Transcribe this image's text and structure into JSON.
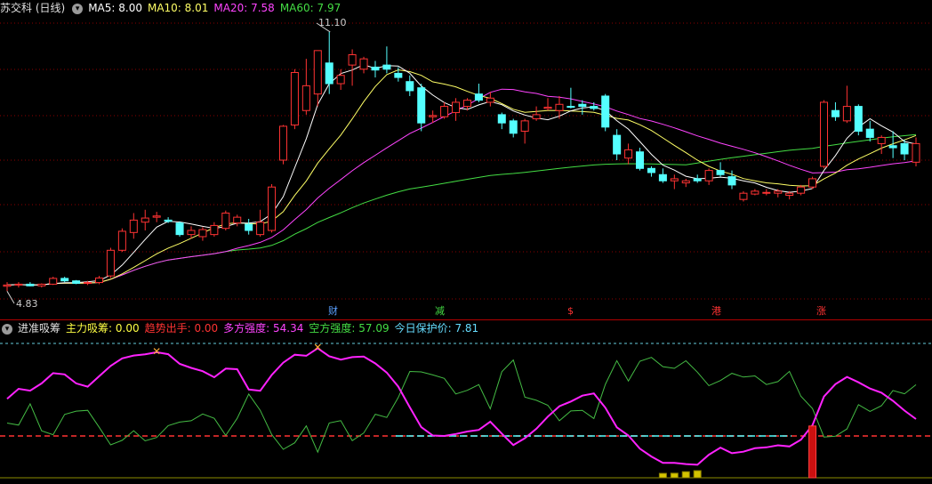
{
  "top_panel": {
    "stock": "苏交科 (日线)",
    "indicators": [
      {
        "label": "MA5: 8.00",
        "color": "#ffffff"
      },
      {
        "label": "MA10: 8.01",
        "color": "#ffff66"
      },
      {
        "label": "MA20: 7.58",
        "color": "#ff44ff"
      },
      {
        "label": "MA60: 7.97",
        "color": "#44dd44"
      }
    ],
    "high_label": "11.10",
    "low_label": "4.83",
    "news_tags": [
      {
        "text": "财",
        "color": "#5aa0ff"
      },
      {
        "text": "减",
        "color": "#44dd44"
      },
      {
        "text": "$",
        "color": "#ff3333"
      },
      {
        "text": "港",
        "color": "#ff3333"
      },
      {
        "text": "涨",
        "color": "#ff3333"
      }
    ]
  },
  "bottom_panel": {
    "name": "进准吸筹",
    "indicators": [
      {
        "label": "主力吸筹: 0.00",
        "color": "#ffff44"
      },
      {
        "label": "趋势出手: 0.00",
        "color": "#ff3333"
      },
      {
        "label": "多方强度: 54.34",
        "color": "#ff44ff"
      },
      {
        "label": "空方强度: 57.09",
        "color": "#44dd44"
      },
      {
        "label": "今日保护价: 7.81",
        "color": "#66ddff"
      }
    ]
  },
  "chart_data": {
    "type": "candlestick",
    "candles": [
      {
        "o": 4.95,
        "h": 5.05,
        "l": 4.83,
        "c": 4.98
      },
      {
        "o": 4.98,
        "h": 5.05,
        "l": 4.92,
        "c": 5.0
      },
      {
        "o": 5.0,
        "h": 5.05,
        "l": 4.95,
        "c": 4.96
      },
      {
        "o": 4.96,
        "h": 5.02,
        "l": 4.92,
        "c": 5.0
      },
      {
        "o": 5.0,
        "h": 5.18,
        "l": 4.98,
        "c": 5.14
      },
      {
        "o": 5.14,
        "h": 5.18,
        "l": 5.05,
        "c": 5.08
      },
      {
        "o": 5.08,
        "h": 5.1,
        "l": 5.0,
        "c": 5.02
      },
      {
        "o": 5.02,
        "h": 5.08,
        "l": 4.98,
        "c": 5.04
      },
      {
        "o": 5.04,
        "h": 5.2,
        "l": 5.0,
        "c": 5.15
      },
      {
        "o": 5.2,
        "h": 5.88,
        "l": 5.15,
        "c": 5.82
      },
      {
        "o": 5.82,
        "h": 6.35,
        "l": 5.78,
        "c": 6.28
      },
      {
        "o": 6.25,
        "h": 6.72,
        "l": 6.1,
        "c": 6.55
      },
      {
        "o": 6.5,
        "h": 6.8,
        "l": 6.3,
        "c": 6.6
      },
      {
        "o": 6.62,
        "h": 6.75,
        "l": 6.5,
        "c": 6.65
      },
      {
        "o": 6.55,
        "h": 6.62,
        "l": 6.48,
        "c": 6.52
      },
      {
        "o": 6.48,
        "h": 6.52,
        "l": 6.15,
        "c": 6.2
      },
      {
        "o": 6.2,
        "h": 6.4,
        "l": 6.1,
        "c": 6.3
      },
      {
        "o": 6.15,
        "h": 6.38,
        "l": 6.05,
        "c": 6.32
      },
      {
        "o": 6.2,
        "h": 6.5,
        "l": 6.15,
        "c": 6.42
      },
      {
        "o": 6.35,
        "h": 6.78,
        "l": 6.3,
        "c": 6.72
      },
      {
        "o": 6.48,
        "h": 6.68,
        "l": 6.4,
        "c": 6.62
      },
      {
        "o": 6.45,
        "h": 6.58,
        "l": 6.2,
        "c": 6.3
      },
      {
        "o": 6.2,
        "h": 6.8,
        "l": 6.15,
        "c": 6.5
      },
      {
        "o": 6.3,
        "h": 7.42,
        "l": 6.25,
        "c": 7.35
      },
      {
        "o": 8.0,
        "h": 8.85,
        "l": 7.9,
        "c": 8.82
      },
      {
        "o": 8.85,
        "h": 10.2,
        "l": 8.75,
        "c": 10.12
      },
      {
        "o": 9.2,
        "h": 10.45,
        "l": 9.1,
        "c": 9.8
      },
      {
        "o": 9.6,
        "h": 10.55,
        "l": 9.3,
        "c": 10.65
      },
      {
        "o": 10.35,
        "h": 11.1,
        "l": 9.6,
        "c": 9.85
      },
      {
        "o": 9.85,
        "h": 10.2,
        "l": 9.7,
        "c": 10.05
      },
      {
        "o": 10.3,
        "h": 10.68,
        "l": 9.8,
        "c": 10.55
      },
      {
        "o": 10.2,
        "h": 10.5,
        "l": 10.1,
        "c": 10.45
      },
      {
        "o": 10.25,
        "h": 10.4,
        "l": 10.0,
        "c": 10.18
      },
      {
        "o": 10.3,
        "h": 10.75,
        "l": 10.1,
        "c": 10.2
      },
      {
        "o": 10.1,
        "h": 10.25,
        "l": 9.9,
        "c": 10.0
      },
      {
        "o": 9.9,
        "h": 10.05,
        "l": 9.55,
        "c": 9.68
      },
      {
        "o": 9.75,
        "h": 9.85,
        "l": 8.7,
        "c": 8.9
      },
      {
        "o": 9.05,
        "h": 9.2,
        "l": 8.9,
        "c": 9.08
      },
      {
        "o": 9.05,
        "h": 9.4,
        "l": 9.0,
        "c": 9.3
      },
      {
        "o": 9.15,
        "h": 9.5,
        "l": 8.95,
        "c": 9.4
      },
      {
        "o": 9.3,
        "h": 9.5,
        "l": 9.2,
        "c": 9.45
      },
      {
        "o": 9.6,
        "h": 9.85,
        "l": 9.4,
        "c": 9.45
      },
      {
        "o": 9.4,
        "h": 9.65,
        "l": 9.3,
        "c": 9.5
      },
      {
        "o": 9.1,
        "h": 9.15,
        "l": 8.75,
        "c": 8.9
      },
      {
        "o": 8.95,
        "h": 9.0,
        "l": 8.55,
        "c": 8.65
      },
      {
        "o": 8.7,
        "h": 9.0,
        "l": 8.4,
        "c": 8.95
      },
      {
        "o": 9.0,
        "h": 9.3,
        "l": 8.95,
        "c": 9.1
      },
      {
        "o": 9.25,
        "h": 9.5,
        "l": 9.2,
        "c": 9.28
      },
      {
        "o": 9.2,
        "h": 9.55,
        "l": 9.0,
        "c": 9.35
      },
      {
        "o": 9.3,
        "h": 9.75,
        "l": 9.25,
        "c": 9.28
      },
      {
        "o": 9.35,
        "h": 9.45,
        "l": 9.1,
        "c": 9.3
      },
      {
        "o": 9.3,
        "h": 9.4,
        "l": 9.2,
        "c": 9.25
      },
      {
        "o": 9.55,
        "h": 9.6,
        "l": 8.7,
        "c": 8.8
      },
      {
        "o": 8.6,
        "h": 8.75,
        "l": 8.0,
        "c": 8.15
      },
      {
        "o": 8.05,
        "h": 8.4,
        "l": 7.9,
        "c": 8.25
      },
      {
        "o": 8.2,
        "h": 8.3,
        "l": 7.75,
        "c": 7.8
      },
      {
        "o": 7.8,
        "h": 7.85,
        "l": 7.6,
        "c": 7.7
      },
      {
        "o": 7.65,
        "h": 7.8,
        "l": 7.45,
        "c": 7.5
      },
      {
        "o": 7.5,
        "h": 7.65,
        "l": 7.3,
        "c": 7.55
      },
      {
        "o": 7.45,
        "h": 7.55,
        "l": 7.35,
        "c": 7.5
      },
      {
        "o": 7.55,
        "h": 7.65,
        "l": 7.45,
        "c": 7.5
      },
      {
        "o": 7.5,
        "h": 7.8,
        "l": 7.4,
        "c": 7.75
      },
      {
        "o": 7.75,
        "h": 7.95,
        "l": 7.6,
        "c": 7.65
      },
      {
        "o": 7.6,
        "h": 7.75,
        "l": 7.3,
        "c": 7.4
      },
      {
        "o": 7.05,
        "h": 7.25,
        "l": 7.0,
        "c": 7.2
      },
      {
        "o": 7.18,
        "h": 7.3,
        "l": 7.15,
        "c": 7.25
      },
      {
        "o": 7.2,
        "h": 7.3,
        "l": 7.15,
        "c": 7.22
      },
      {
        "o": 7.2,
        "h": 7.3,
        "l": 7.1,
        "c": 7.25
      },
      {
        "o": 7.15,
        "h": 7.25,
        "l": 7.05,
        "c": 7.2
      },
      {
        "o": 7.2,
        "h": 7.4,
        "l": 7.15,
        "c": 7.35
      },
      {
        "o": 7.35,
        "h": 7.6,
        "l": 7.3,
        "c": 7.55
      },
      {
        "o": 7.85,
        "h": 9.45,
        "l": 7.8,
        "c": 9.4
      },
      {
        "o": 9.2,
        "h": 9.4,
        "l": 8.95,
        "c": 9.05
      },
      {
        "o": 8.95,
        "h": 9.8,
        "l": 8.9,
        "c": 9.3
      },
      {
        "o": 9.3,
        "h": 9.35,
        "l": 8.6,
        "c": 8.7
      },
      {
        "o": 8.75,
        "h": 8.95,
        "l": 8.45,
        "c": 8.55
      },
      {
        "o": 8.4,
        "h": 8.6,
        "l": 8.15,
        "c": 8.55
      },
      {
        "o": 8.35,
        "h": 8.7,
        "l": 8.05,
        "c": 8.3
      },
      {
        "o": 8.4,
        "h": 8.5,
        "l": 8.0,
        "c": 8.15
      },
      {
        "o": 7.95,
        "h": 8.55,
        "l": 7.85,
        "c": 8.4
      }
    ],
    "bottom_levels": {
      "upper": 95,
      "middle": 30
    }
  }
}
